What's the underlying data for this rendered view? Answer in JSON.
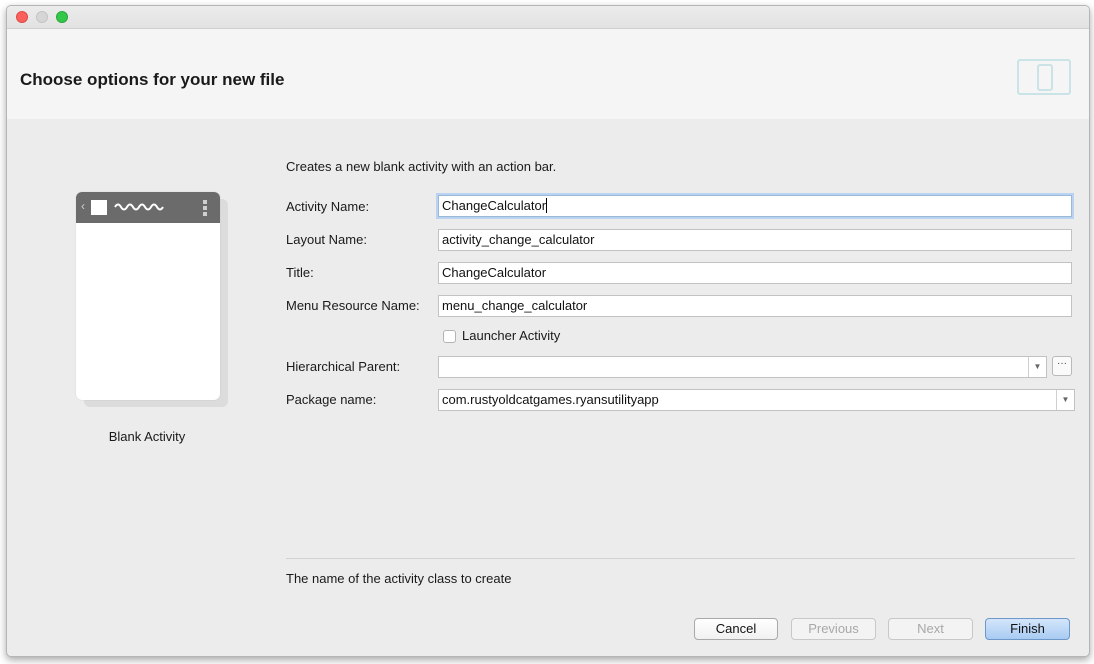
{
  "header": {
    "title": "Choose options for your new file"
  },
  "template": {
    "name": "Blank Activity"
  },
  "form": {
    "description": "Creates a new blank activity with an action bar.",
    "activity_name": {
      "label": "Activity Name:",
      "value": "ChangeCalculator"
    },
    "layout_name": {
      "label": "Layout Name:",
      "value": "activity_change_calculator"
    },
    "title": {
      "label": "Title:",
      "value": "ChangeCalculator"
    },
    "menu_resource_name": {
      "label": "Menu Resource Name:",
      "value": "menu_change_calculator"
    },
    "launcher_activity": {
      "label": "Launcher Activity",
      "checked": false
    },
    "hierarchical_parent": {
      "label": "Hierarchical Parent:",
      "value": "",
      "browse_label": "···"
    },
    "package_name": {
      "label": "Package name:",
      "value": "com.rustyoldcatgames.ryansutilityapp"
    }
  },
  "hint": "The name of the activity class to create",
  "buttons": {
    "cancel": "Cancel",
    "previous": "Previous",
    "next": "Next",
    "finish": "Finish"
  },
  "icons": {
    "window_controls": [
      "close-icon",
      "minimize-icon",
      "zoom-icon"
    ],
    "header": "device-form-factor-icon",
    "dropdown": "chevron-down-icon"
  },
  "colors": {
    "default_button": "#a9cbf2",
    "focus_ring": "#b9d3f0",
    "preview_action_bar": "#6b6b6b"
  }
}
